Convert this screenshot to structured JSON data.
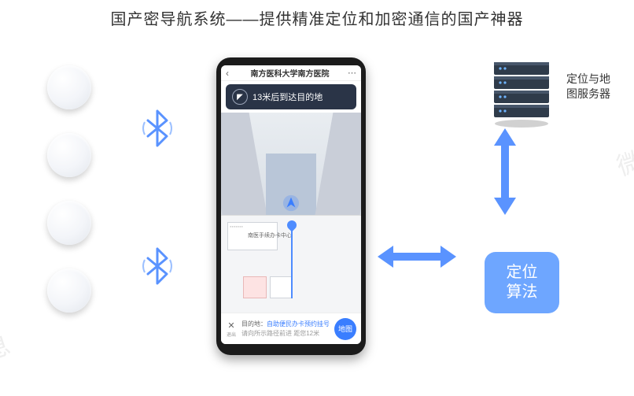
{
  "title": "国产密导航系统——提供精准定位和加密通信的国产神器",
  "beacons": {
    "count": 4
  },
  "bluetooth_icon": "bluetooth-icon",
  "phone": {
    "header_title": "南方医科大学南方医院",
    "nav_banner": "13米后到达目的地",
    "floorplan_label": "南医手续办卡中心",
    "destination": {
      "close_label": "退出",
      "label": "目的地：",
      "value": "自助便民办卡预约挂号",
      "hint": "请向所示路径前进 距您12米",
      "button": "地图"
    }
  },
  "server": {
    "label": "定位与地图服务器"
  },
  "algorithm": {
    "label": "定位\n算法"
  },
  "arrows": {
    "phone_to_algo": "bidirectional",
    "algo_to_server": "bidirectional"
  },
  "colors": {
    "accent": "#6ea6ff",
    "arrow": "#5a93ff",
    "banner": "#2a3447"
  }
}
